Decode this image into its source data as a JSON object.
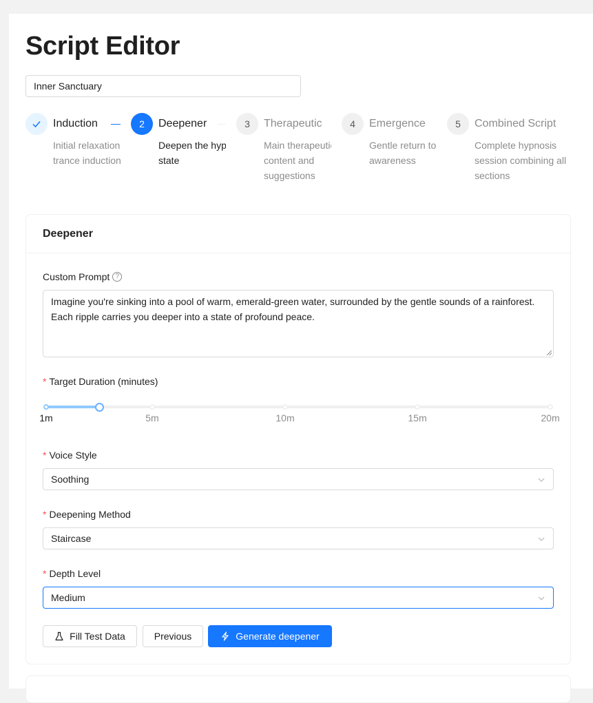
{
  "page": {
    "title": "Script Editor"
  },
  "script_name": {
    "value": "Inner Sanctuary"
  },
  "steps": [
    {
      "number": "1",
      "title": "Induction",
      "desc_lines": [
        "Initial relaxation",
        "trance induction"
      ],
      "status": "finish"
    },
    {
      "number": "2",
      "title": "Deepener",
      "desc_lines": [
        "Deepen the hypnotic",
        "state"
      ],
      "status": "process"
    },
    {
      "number": "3",
      "title": "Therapeutic",
      "desc_lines": [
        "Main therapeutic",
        "content and",
        "suggestions"
      ],
      "status": "wait"
    },
    {
      "number": "4",
      "title": "Emergence",
      "desc_lines": [
        "Gentle return to",
        "awareness"
      ],
      "status": "wait"
    },
    {
      "number": "5",
      "title": "Combined Script",
      "desc_lines": [
        "Complete hypnosis",
        "session combining all",
        "sections"
      ],
      "status": "wait"
    }
  ],
  "card": {
    "title": "Deepener",
    "custom_prompt": {
      "label": "Custom Prompt",
      "value": "Imagine you're sinking into a pool of warm, emerald-green water, surrounded by the gentle sounds of a rainforest. Each ripple carries you deeper into a state of profound peace."
    },
    "duration": {
      "label": "Target Duration (minutes)",
      "min": 1,
      "max": 20,
      "value": 3,
      "marks": [
        "1m",
        "5m",
        "10m",
        "15m",
        "20m"
      ]
    },
    "voice_style": {
      "label": "Voice Style",
      "value": "Soothing"
    },
    "deepening_method": {
      "label": "Deepening Method",
      "value": "Staircase"
    },
    "depth_level": {
      "label": "Depth Level",
      "value": "Medium"
    },
    "buttons": {
      "fill_test": "Fill Test Data",
      "previous": "Previous",
      "generate": "Generate deepener"
    }
  },
  "colors": {
    "primary": "#1677ff",
    "primary_light": "#e6f4ff",
    "slider_track": "#91caff",
    "required": "#ff4d4f"
  }
}
